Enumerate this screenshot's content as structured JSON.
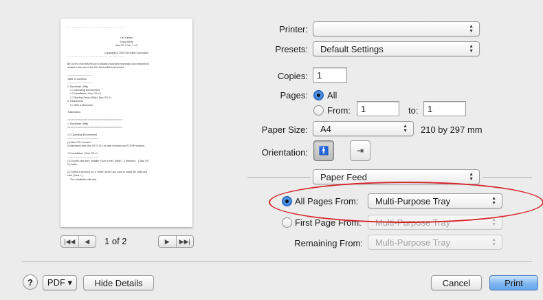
{
  "preview": {
    "lines": [
      "- - - - - - - - - - - - - - - - - - - - - - - - - - - - - - - - - - - - - -",
      "-",
      "",
      "OKI Device",
      "Setup Utility",
      "Mac OS X Ver. 1.4.0",
      "",
      "Copyright(C) 2009 Oki Data Corporation",
      "- - - - - - - - - - - - - - - - - - - - - - - - - - - - - - - - - - - - - -",
      "-",
      "Be sure to read this file as it contains important information and restrictions",
      "related to the use of the OKI Device/Ethernet board.",
      "",
      "------------------------------",
      "Table of Contents",
      "------------------------------",
      "1. Macintosh Utility",
      "    1.1 Operating Environment",
      "    1.2 Installation ( Mac OS X )",
      "    1.3 Starting Setup Utility ( Mac OS X )",
      "2. Restrictions",
      "    2.1 With a Macintosh",
      "",
      "Trademarks",
      "",
      "======================================",
      "1. Macintosh Utility",
      "======================================",
      "",
      "1.1 Operating Environment",
      "--------------------------------------",
      "(1) Mac OS X version",
      "A Macintosh with Mac OS X 10.1 or later installed and TCP/IP enabled.",
      "",
      "1.2 Installation ( Mac OS X )",
      "--------------------------------------",
      "(1) Double-click the [ Installer ] icon in the [ Utility ] - [ Network ] - [ Mac OS",
      "X ] folder.",
      "",
      "(2) Select a directory (or a  folder) where you want to install the utility and",
      "click [ Next > ].",
      "    The installation will start."
    ],
    "centered": [
      3,
      4,
      5,
      7
    ],
    "page_count": "1 of 2",
    "nav_first": "|◀◀",
    "nav_prev": "◀",
    "nav_next": "▶",
    "nav_last": "▶▶|"
  },
  "printer": {
    "label": "Printer:",
    "value": ""
  },
  "presets": {
    "label": "Presets:",
    "value": "Default Settings"
  },
  "copies": {
    "label": "Copies:",
    "value": "1"
  },
  "pages": {
    "label": "Pages:",
    "all_label": "All",
    "from_label": "From:",
    "from_value": "1",
    "to_label": "to:",
    "to_value": "1"
  },
  "paper_size": {
    "label": "Paper Size:",
    "value": "A4",
    "dimensions": "210 by 297 mm"
  },
  "orientation": {
    "label": "Orientation:",
    "portrait_glyph": "🚹",
    "landscape_glyph": "⇥"
  },
  "section": {
    "value": "Paper Feed"
  },
  "paper_feed": {
    "all_pages_label": "All Pages From:",
    "all_pages_value": "Multi-Purpose Tray",
    "first_page_label": "First Page From:",
    "first_page_value": "Multi-Purpose Tray",
    "remaining_label": "Remaining From:",
    "remaining_value": "Multi-Purpose Tray"
  },
  "footer": {
    "help": "?",
    "pdf": "PDF ▾",
    "hide_details": "Hide Details",
    "cancel": "Cancel",
    "print": "Print"
  },
  "colors": {
    "highlight": "#d7262a",
    "default_button": "#6aa7ec"
  }
}
